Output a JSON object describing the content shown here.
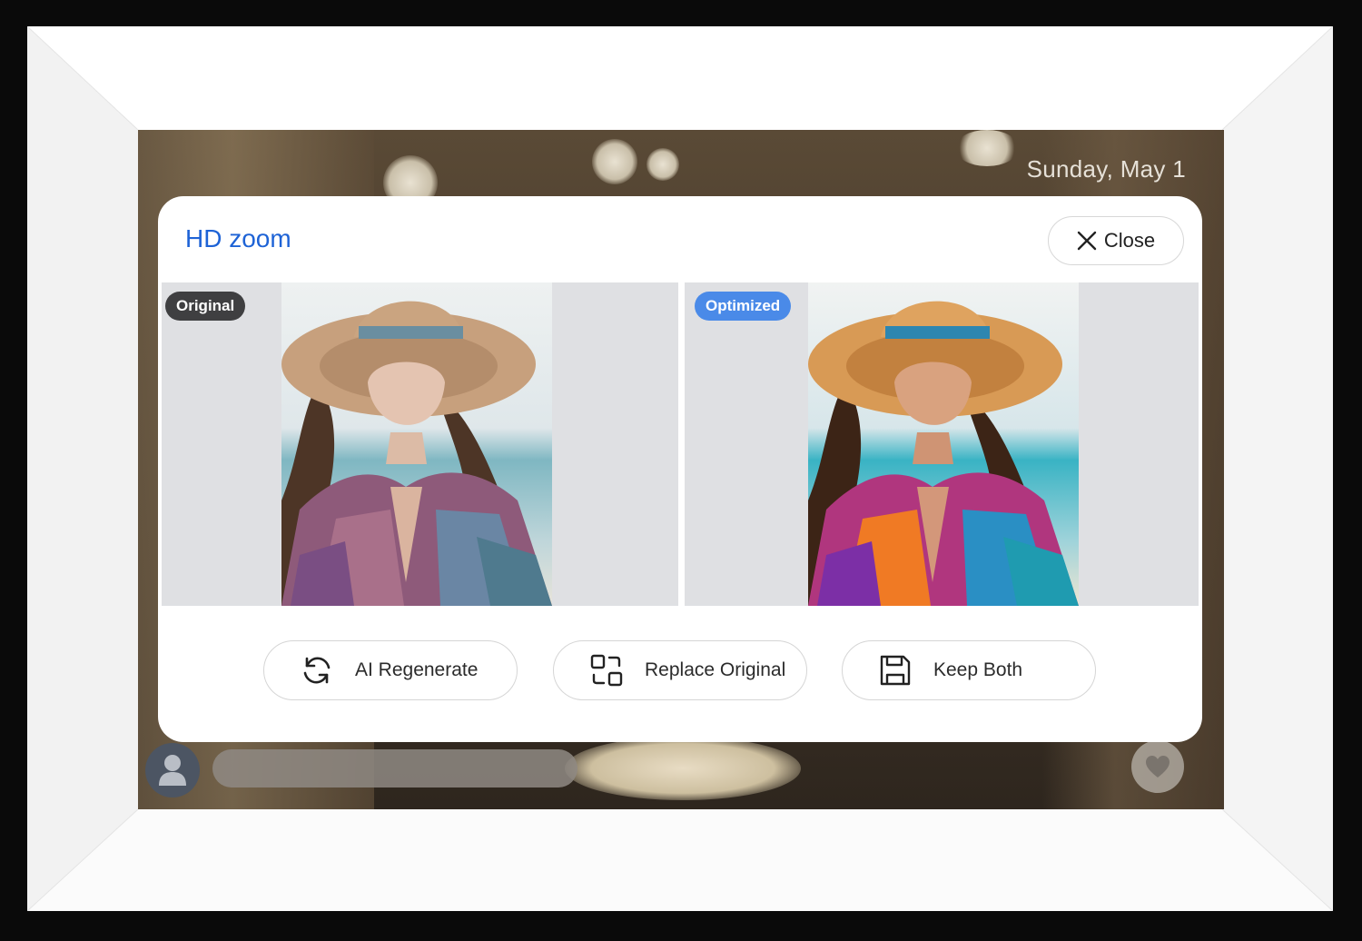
{
  "screen": {
    "date": "Sunday, May 1"
  },
  "dialog": {
    "title": "HD zoom",
    "close_label": "Close",
    "original_badge": "Original",
    "optimized_badge": "Optimized",
    "actions": [
      {
        "label": "AI Regenerate",
        "icon": "refresh-icon"
      },
      {
        "label": "Replace Original",
        "icon": "replace-icon"
      },
      {
        "label": "Keep Both",
        "icon": "save-icon"
      }
    ]
  },
  "colors": {
    "title_blue": "#1e63d6",
    "optimized_badge": "#4a8ae8",
    "original_badge": "#3f3f41"
  }
}
